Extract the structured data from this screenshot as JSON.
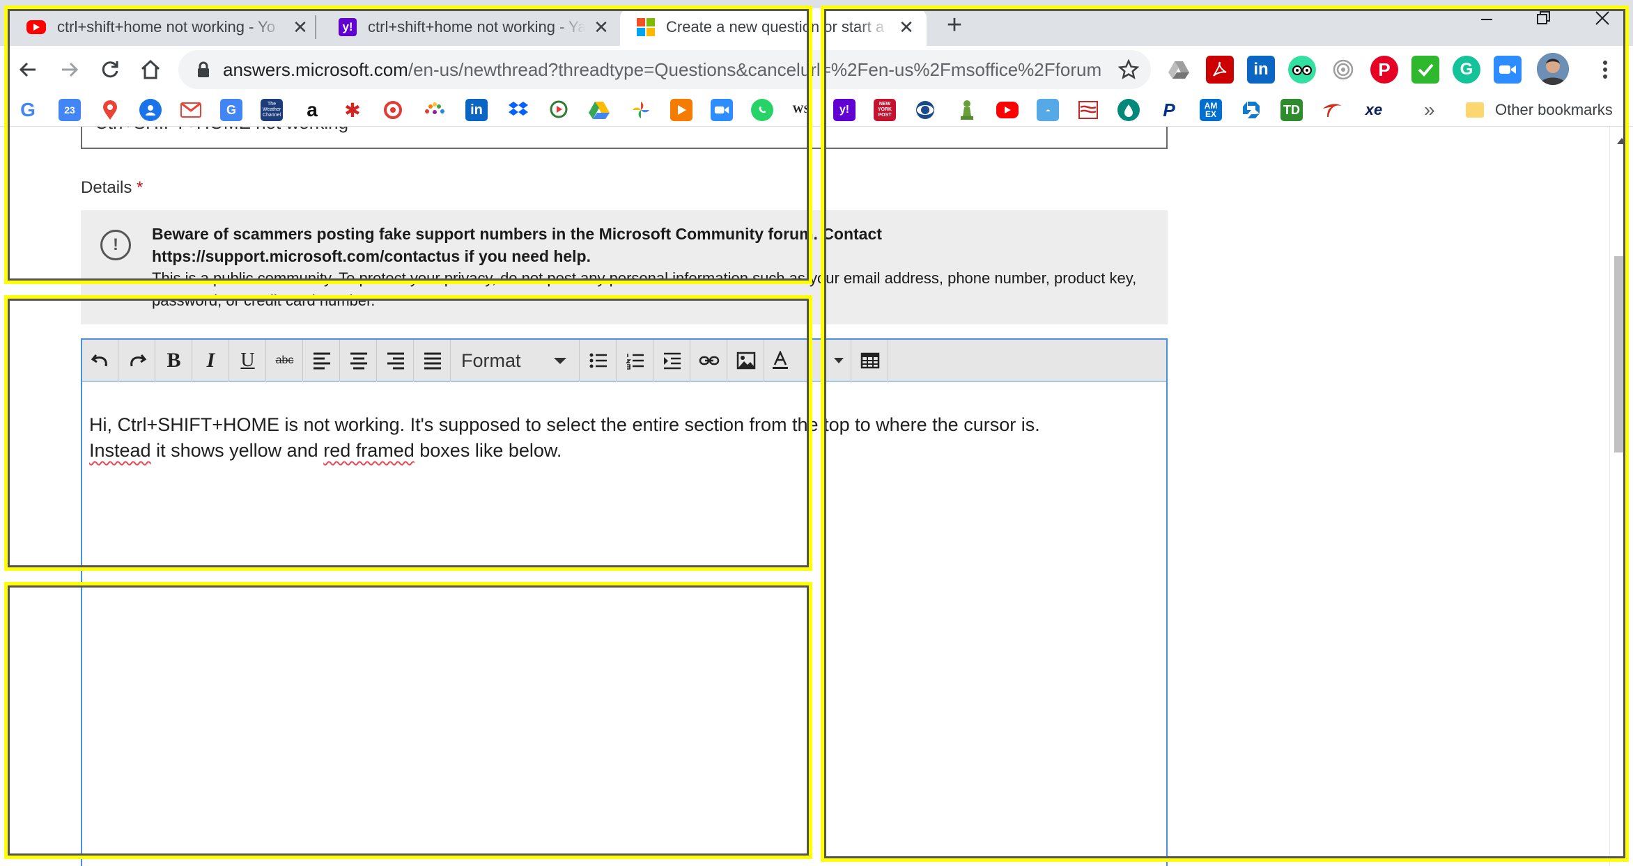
{
  "browser": {
    "tabs": [
      {
        "title": "ctrl+shift+home not working - Yo",
        "favicon": "youtube-icon",
        "active": false
      },
      {
        "title": "ctrl+shift+home not working - Ya",
        "favicon": "yahoo-icon",
        "active": false
      },
      {
        "title": "Create a new question or start a d",
        "favicon": "microsoft-icon",
        "active": true
      }
    ],
    "new_tab": "+",
    "address_host": "answers.microsoft.com",
    "address_path": "/en-us/newthread?threadtype=Questions&cancelurl=%2Fen-us%2Fmsoffice%2Fforum...",
    "bookmarks_overflow": "»",
    "other_bookmarks": "Other bookmarks",
    "bookmark_labels": {
      "calendar": "23",
      "weather": "The Weather Channel",
      "amazon": "a",
      "linkedin": "in",
      "ws": "WS",
      "yahoo": "y!",
      "nypost": "NEW YORK POST",
      "amex": "AM EX",
      "td": "TD",
      "xe": "xe",
      "paypal": "P"
    }
  },
  "form": {
    "subject_value": "Ctrl+SHIFT+HOME not working",
    "details_label": "Details",
    "required_mark": "*",
    "notice_title": "Beware of scammers posting fake support numbers in the Microsoft Community forum. Contact https://support.microsoft.com/contactus if you need help.",
    "notice_body": "This is a public community. To protect your privacy, do not post any personal information such as your email address, phone number, product key, password, or credit card number.",
    "notice_icon": "!"
  },
  "editor": {
    "toolbar": {
      "bold": "B",
      "italic": "I",
      "underline": "U",
      "strike": "abc",
      "format": "Format"
    },
    "line1": "Hi, Ctrl+SHIFT+HOME is not working.  It's supposed to select the entire section from the top to where the cursor is.",
    "line2_a": "Instead",
    "line2_b": " it shows yellow and ",
    "line2_c": "red framed",
    "line2_d": " boxes like below."
  },
  "colors": {
    "annotation_frame": "#ffff00",
    "editor_border": "#4a90d9",
    "spellcheck": "#e5485b"
  }
}
